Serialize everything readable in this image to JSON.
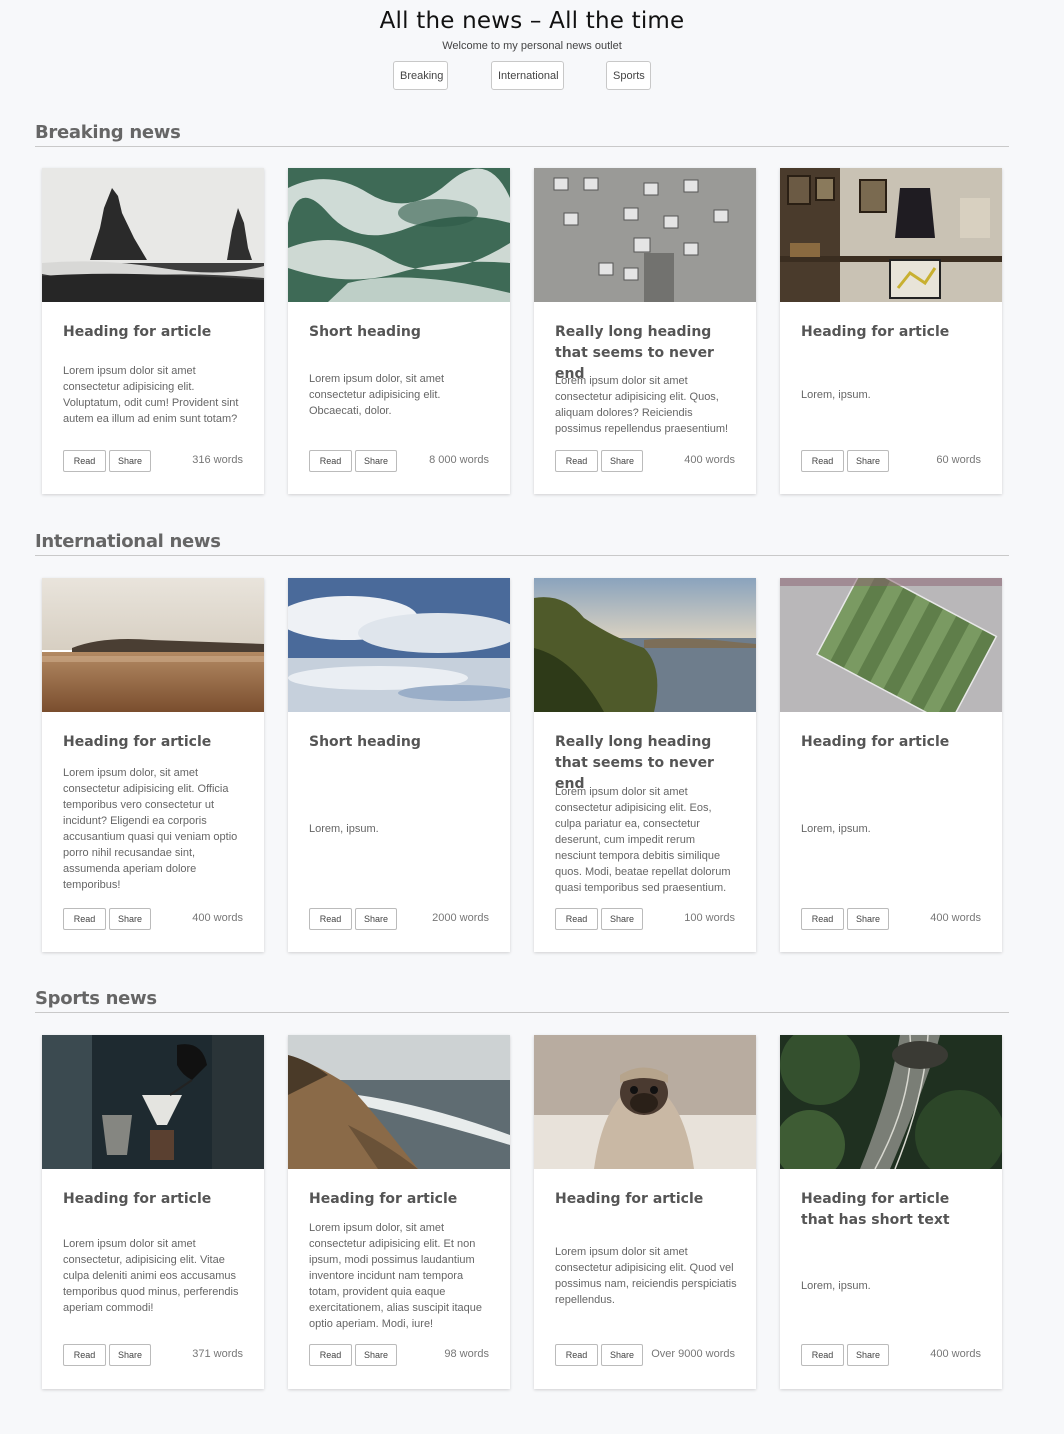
{
  "site": {
    "title": "All the news – All the time",
    "subtitle": "Welcome to my personal news outlet",
    "nav": [
      "Breaking",
      "International",
      "Sports"
    ]
  },
  "buttons": {
    "read": "Read",
    "share": "Share"
  },
  "sections": [
    {
      "title": "Breaking news",
      "cards": [
        {
          "heading": "Heading for article",
          "text": "Lorem ipsum dolor sit amet consectetur adipisicing elit. Voluptatum, odit cum! Provident sint autem ea illum ad enim sunt totam?",
          "words": "316 words",
          "image": "sea-stacks-photo"
        },
        {
          "heading": "Short heading",
          "text": "Lorem ipsum dolor, sit amet consectetur adipisicing elit. Obcaecati, dolor.",
          "words": "8 000 words",
          "image": "ocean-waves-photo"
        },
        {
          "heading": "Really long heading that seems to never end",
          "text": "Lorem ipsum dolor sit amet consectetur adipisicing elit. Quos, aliquam dolores? Reiciendis possimus repellendus praesentium!",
          "words": "400 words",
          "image": "old-building-photo"
        },
        {
          "heading": "Heading for article",
          "text": "Lorem, ipsum.",
          "words": "60 words",
          "image": "shop-interior-photo"
        }
      ]
    },
    {
      "title": "International news",
      "cards": [
        {
          "heading": "Heading for article",
          "text": "Lorem ipsum dolor, sit amet consectetur adipisicing elit. Officia temporibus vero consectetur ut incidunt? Eligendi ea corporis accusantium quasi qui veniam optio porro nihil recusandae sint, assumenda aperiam dolore temporibus!",
          "words": "400 words",
          "image": "beach-photo"
        },
        {
          "heading": "Short heading",
          "text": "Lorem, ipsum.",
          "words": "2000 words",
          "image": "cloud-reflection-photo"
        },
        {
          "heading": "Really long heading that seems to never end",
          "text": "Lorem ipsum dolor sit amet consectetur adipisicing elit. Eos, culpa pariatur ea, consectetur deserunt, cum impedit rerum nesciunt tempora debitis similique quos. Modi, beatae repellat dolorum quasi temporibus sed praesentium.",
          "words": "100 words",
          "image": "coastline-photo"
        },
        {
          "heading": "Heading for article",
          "text": "Lorem, ipsum.",
          "words": "400 words",
          "image": "football-stadium-photo"
        }
      ]
    },
    {
      "title": "Sports news",
      "cards": [
        {
          "heading": "Heading for article",
          "text": "Lorem ipsum dolor sit amet consectetur, adipisicing elit. Vitae culpa deleniti animi eos accusamus temporibus quod minus, perferendis aperiam commodi!",
          "words": "371 words",
          "image": "coffee-pour-photo"
        },
        {
          "heading": "Heading for article",
          "text": "Lorem ipsum dolor, sit amet consectetur adipisicing elit. Et non ipsum, modi possimus laudantium inventore incidunt nam tempora totam, provident quia eaque exercitationem, alias suscipit itaque optio aperiam. Modi, iure!",
          "words": "98 words",
          "image": "cliff-beach-photo"
        },
        {
          "heading": "Heading for article",
          "text": "Lorem ipsum dolor sit amet consectetur adipisicing elit. Quod vel possimus nam, reiciendis perspiciatis repellendus.",
          "words": "Over 9000 words",
          "image": "pug-blanket-photo"
        },
        {
          "heading": "Heading for article that has short text",
          "text": "Lorem, ipsum.",
          "words": "400 words",
          "image": "forest-tunnel-photo"
        }
      ]
    }
  ]
}
